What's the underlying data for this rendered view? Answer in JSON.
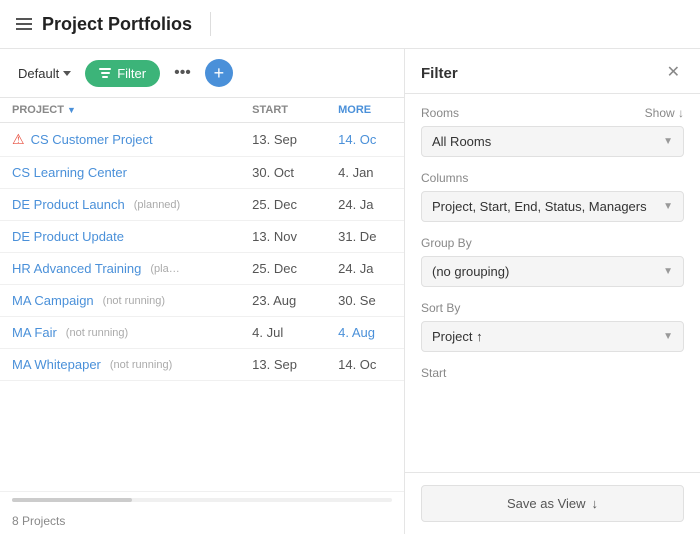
{
  "header": {
    "title": "Project Portfolios"
  },
  "toolbar": {
    "default_label": "Default",
    "filter_label": "Filter",
    "more_label": "•••",
    "add_label": "+"
  },
  "table": {
    "columns": [
      {
        "key": "project",
        "label": "PROJECT",
        "sortable": true
      },
      {
        "key": "start",
        "label": "START"
      },
      {
        "key": "more",
        "label": "MORE"
      }
    ],
    "rows": [
      {
        "name": "CS Customer Project",
        "tag": "",
        "start": "13. Sep",
        "more": "14. Oc",
        "has_error": true,
        "more_is_link": true
      },
      {
        "name": "CS Learning Center",
        "tag": "",
        "start": "30. Oct",
        "more": "4. Jan",
        "has_error": false,
        "more_is_link": false
      },
      {
        "name": "DE Product Launch",
        "tag": "(planned)",
        "start": "25. Dec",
        "more": "24. Ja",
        "has_error": false,
        "more_is_link": false
      },
      {
        "name": "DE Product Update",
        "tag": "",
        "start": "13. Nov",
        "more": "31. De",
        "has_error": false,
        "more_is_link": false
      },
      {
        "name": "HR Advanced Training",
        "tag": "(pla…",
        "start": "25. Dec",
        "more": "24. Ja",
        "has_error": false,
        "more_is_link": false
      },
      {
        "name": "MA Campaign",
        "tag": "(not running)",
        "start": "23. Aug",
        "more": "30. Se",
        "has_error": false,
        "more_is_link": false
      },
      {
        "name": "MA Fair",
        "tag": "(not running)",
        "start": "4. Jul",
        "more": "4. Aug",
        "has_error": false,
        "more_is_link": true
      },
      {
        "name": "MA Whitepaper",
        "tag": "(not running)",
        "start": "13. Sep",
        "more": "14. Oc",
        "has_error": false,
        "more_is_link": false
      }
    ],
    "count_label": "8 Projects"
  },
  "filter_panel": {
    "title": "Filter",
    "rooms": {
      "label": "Rooms",
      "show_label": "Show ↓",
      "value": "All Rooms"
    },
    "columns": {
      "label": "Columns",
      "value": "Project, Start, End, Status, Managers"
    },
    "group_by": {
      "label": "Group By",
      "value": "(no grouping)"
    },
    "sort_by": {
      "label": "Sort By",
      "value": "Project ↑"
    },
    "start": {
      "label": "Start"
    },
    "save_view_label": "Save as View",
    "save_view_arrow": "↓",
    "close_label": "✕"
  },
  "icons": {
    "hamburger": "menu-icon",
    "chevron": "chevron-down-icon",
    "filter": "filter-icon",
    "close": "close-icon",
    "add": "add-icon",
    "sort": "sort-icon"
  }
}
